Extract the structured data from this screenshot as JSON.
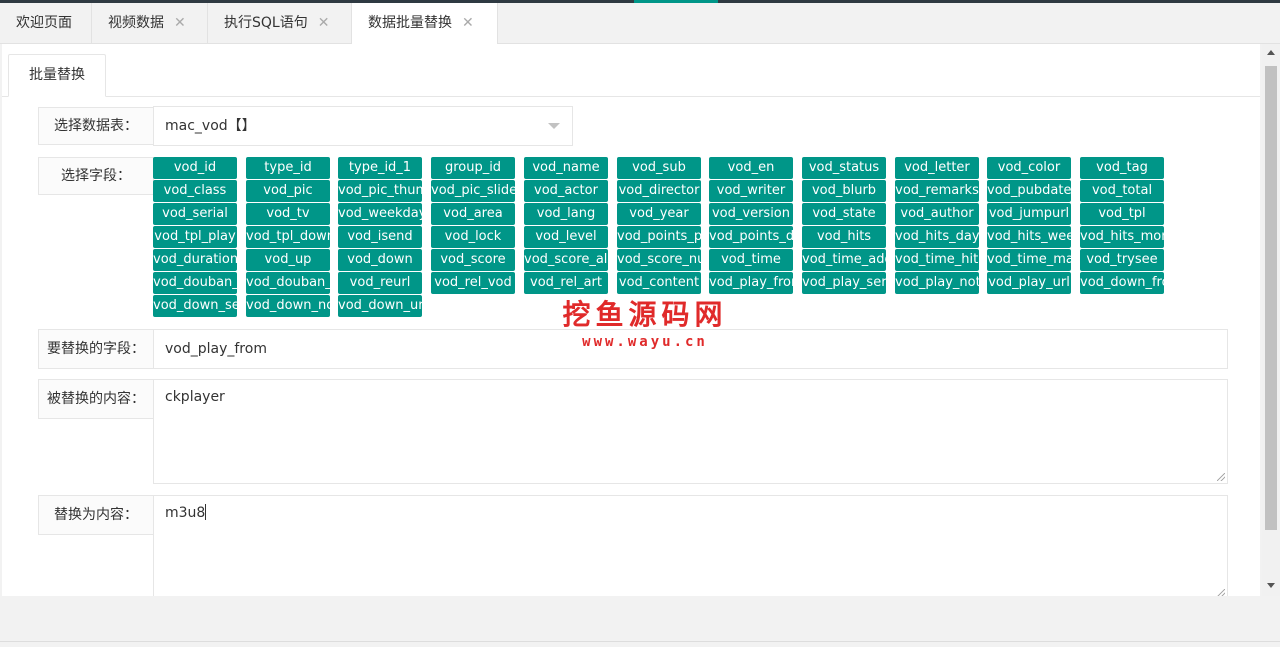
{
  "tabs": [
    {
      "label": "欢迎页面",
      "closable": false,
      "active": false
    },
    {
      "label": "视频数据",
      "closable": true,
      "active": false
    },
    {
      "label": "执行SQL语句",
      "closable": true,
      "active": false
    },
    {
      "label": "数据批量替换",
      "closable": true,
      "active": true
    }
  ],
  "subtab": {
    "label": "批量替换"
  },
  "form": {
    "table_label": "选择数据表：",
    "table_value": "mac_vod【】",
    "fields_label": "选择字段：",
    "target_field_label": "要替换的字段：",
    "target_field_value": "vod_play_from",
    "find_label": "被替换的内容：",
    "find_value": "ckplayer",
    "replace_label": "替换为内容：",
    "replace_value": "m3u8"
  },
  "fields": [
    "vod_id",
    "type_id",
    "type_id_1",
    "group_id",
    "vod_name",
    "vod_sub",
    "vod_en",
    "vod_status",
    "vod_letter",
    "vod_color",
    "vod_tag",
    "vod_class",
    "vod_pic",
    "vod_pic_thumb",
    "vod_pic_slide",
    "vod_actor",
    "vod_director",
    "vod_writer",
    "vod_blurb",
    "vod_remarks",
    "vod_pubdate",
    "vod_total",
    "vod_serial",
    "vod_tv",
    "vod_weekday",
    "vod_area",
    "vod_lang",
    "vod_year",
    "vod_version",
    "vod_state",
    "vod_author",
    "vod_jumpurl",
    "vod_tpl",
    "vod_tpl_play",
    "vod_tpl_down",
    "vod_isend",
    "vod_lock",
    "vod_level",
    "vod_points_play",
    "vod_points_down",
    "vod_hits",
    "vod_hits_day",
    "vod_hits_week",
    "vod_hits_month",
    "vod_duration",
    "vod_up",
    "vod_down",
    "vod_score",
    "vod_score_all",
    "vod_score_num",
    "vod_time",
    "vod_time_add",
    "vod_time_hits",
    "vod_time_make",
    "vod_trysee",
    "vod_douban_id",
    "vod_douban_score",
    "vod_reurl",
    "vod_rel_vod",
    "vod_rel_art",
    "vod_content",
    "vod_play_from",
    "vod_play_server",
    "vod_play_note",
    "vod_play_url",
    "vod_down_from",
    "vod_down_server",
    "vod_down_note",
    "vod_down_url"
  ],
  "watermark": {
    "cn": "挖鱼源码网",
    "en": "www.wayu.cn"
  },
  "colors": {
    "chip_bg": "#009688",
    "watermark": "#e02a2a",
    "accent": "#009688"
  }
}
